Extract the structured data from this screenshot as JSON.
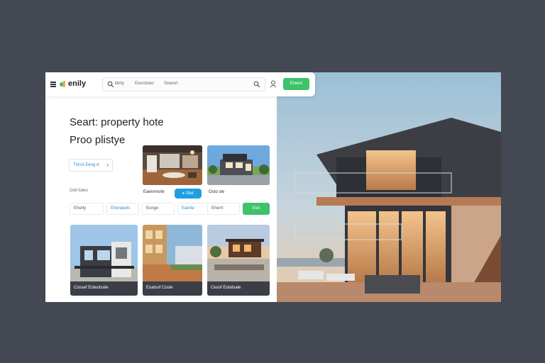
{
  "header": {
    "logo_text": "enily",
    "search": {
      "filter_1": "kbrty",
      "filter_2": "Eexrotoes",
      "placeholder": "Searort"
    },
    "cta_label": "Ereest"
  },
  "hero": {
    "title_line_1": "Seart: property hote",
    "title_line_2": "Proo plistye"
  },
  "filters": {
    "link_button_label": "Thrnd Eeng d",
    "section_label": "Ootl tuleo",
    "fields": [
      {
        "label": "Eherly",
        "style": "plain"
      },
      {
        "label": "Eherqeets",
        "style": "blue"
      },
      {
        "label": "Eungo",
        "style": "plain"
      },
      {
        "label": "Eaerte",
        "style": "blue"
      },
      {
        "label": "Eherrt",
        "style": "plain"
      }
    ],
    "apply_label": "Eeo"
  },
  "featured": {
    "card_1_caption": "Eaenrreofe",
    "card_2_pill": "Stet",
    "card_3_caption": "Osto sle"
  },
  "listings": [
    {
      "caption": "Cossef Eoteutsole"
    },
    {
      "caption": "Eoatsof Cosle"
    },
    {
      "caption": "Cesof Eotatsale"
    }
  ],
  "colors": {
    "background": "#434853",
    "accent_green": "#3ec26b",
    "accent_blue": "#1f9fe0",
    "caption_bar": "#3b3e47"
  }
}
